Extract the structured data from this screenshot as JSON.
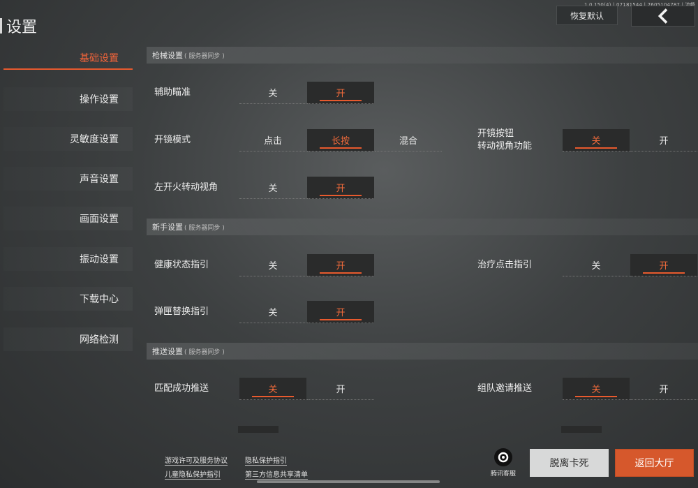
{
  "version": "1.0.150(4) | 07181544 | 7605104787 | 流畅",
  "title": "设置",
  "header": {
    "restore_label": "恢复默认",
    "back_icon": "chevron-left-icon"
  },
  "sidebar": {
    "items": [
      {
        "label": "基础设置",
        "active": true
      },
      {
        "label": "操作设置"
      },
      {
        "label": "灵敏度设置"
      },
      {
        "label": "声音设置"
      },
      {
        "label": "画面设置"
      },
      {
        "label": "振动设置"
      },
      {
        "label": "下载中心"
      },
      {
        "label": "网络检测"
      }
    ]
  },
  "sections": {
    "weapon": {
      "title": "枪械设置",
      "sub": "( 服务器同步 )"
    },
    "newbie": {
      "title": "新手设置",
      "sub": "( 服务器同步 )"
    },
    "push": {
      "title": "推送设置",
      "sub": "( 服务器同步 )"
    }
  },
  "settings": {
    "aim_assist": {
      "label": "辅助瞄准",
      "off": "关",
      "on": "开",
      "selected": "开"
    },
    "scope_mode": {
      "label": "开镜模式",
      "opt1": "点击",
      "opt2": "长按",
      "opt3": "混合",
      "selected": "长按"
    },
    "scope_button_view": {
      "label_line1": "开镜按钮",
      "label_line2": "转动视角功能",
      "off": "关",
      "on": "开",
      "selected": "关"
    },
    "left_fire_view": {
      "label": "左开火转动视角",
      "off": "关",
      "on": "开",
      "selected": "开"
    },
    "health_guide": {
      "label": "健康状态指引",
      "off": "关",
      "on": "开",
      "selected": "开"
    },
    "heal_click_guide": {
      "label": "治疗点击指引",
      "off": "关",
      "on": "开",
      "selected": "开"
    },
    "mag_swap_guide": {
      "label": "弹匣替换指引",
      "off": "关",
      "on": "开",
      "selected": "开"
    },
    "match_push": {
      "label": "匹配成功推送",
      "off": "关",
      "on": "开",
      "selected": "关"
    },
    "team_invite_push": {
      "label": "组队邀请推送",
      "off": "关",
      "on": "开",
      "selected": "关"
    }
  },
  "footer": {
    "links": [
      "游戏许可及服务协议",
      "隐私保护指引",
      "儿童隐私保护指引",
      "第三方信息共享清单"
    ],
    "support_label": "腾讯客服",
    "leave_label": "脱离卡死",
    "lobby_label": "返回大厅"
  },
  "colors": {
    "accent": "#e85a2e",
    "lobby_button": "#d6582c"
  }
}
